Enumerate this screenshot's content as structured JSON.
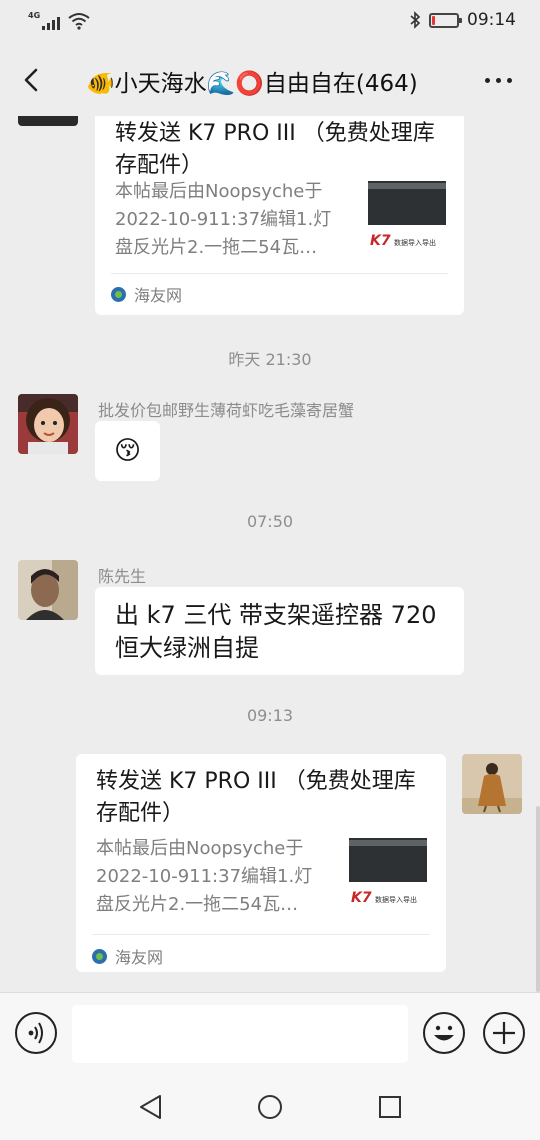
{
  "status_bar": {
    "network": "4G",
    "time": "09:14",
    "battery_level": 0.12,
    "icons": [
      "signal-icon",
      "wifi-icon",
      "bluetooth-icon",
      "battery-icon"
    ]
  },
  "header": {
    "title": "🐠小天海水🌊⭕自由自在(464)",
    "back_icon": "back-arrow-icon",
    "more_icon": "more-dots-icon"
  },
  "messages": [
    {
      "type": "link-card",
      "title": "转发送 K7 PRO III （免费处理库存配件）",
      "description_line1": "本帖最后由Noopsyche于",
      "description_line2": "2022-10-911:37编辑1.灯",
      "description_line3": "盘反光片2.一拖二54瓦…",
      "thumb_text": "K7",
      "thumb_caption": "数据导入导出",
      "source": "海友网"
    },
    {
      "type": "timestamp",
      "text": "昨天 21:30"
    },
    {
      "type": "text",
      "sender": "批发价包邮野生薄荷虾吃毛藻寄居蟹",
      "text": "😚"
    },
    {
      "type": "timestamp",
      "text": "07:50"
    },
    {
      "type": "text",
      "sender": "陈先生",
      "text": "出 k7 三代 带支架遥控器 720 恒大绿洲自提"
    },
    {
      "type": "timestamp",
      "text": "09:13"
    },
    {
      "type": "link-card",
      "self": true,
      "title": "转发送 K7 PRO III （免费处理库存配件）",
      "description_line1": "本帖最后由Noopsyche于",
      "description_line2": "2022-10-911:37编辑1.灯",
      "description_line3": "盘反光片2.一拖二54瓦…",
      "thumb_text": "K7",
      "thumb_caption": "数据导入导出",
      "source": "海友网"
    }
  ],
  "input_bar": {
    "placeholder": "",
    "icons": [
      "voice-icon",
      "emoji-icon",
      "plus-icon"
    ]
  },
  "nav_bar": {
    "icons": [
      "nav-back-icon",
      "nav-home-icon",
      "nav-recents-icon"
    ]
  },
  "colors": {
    "background": "#ededed",
    "bubble": "#ffffff",
    "battery_low": "#e53935",
    "secondary_text": "#7f7f7f"
  }
}
